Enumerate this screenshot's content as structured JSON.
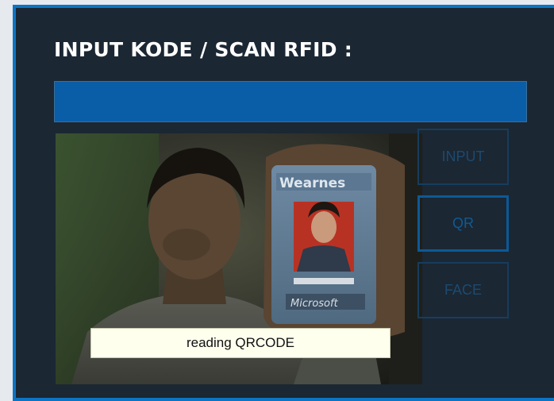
{
  "header": {
    "title": "INPUT KODE / SCAN RFID :"
  },
  "code_input": {
    "value": "",
    "placeholder": ""
  },
  "camera": {
    "status_text": "reading QRCODE"
  },
  "buttons": {
    "input_label": "INPUT",
    "qr_label": "QR",
    "face_label": "FACE",
    "active": "QR"
  },
  "colors": {
    "panel": "#1b2733",
    "accent": "#0c74c4",
    "input_bg": "#0a5ea8"
  }
}
